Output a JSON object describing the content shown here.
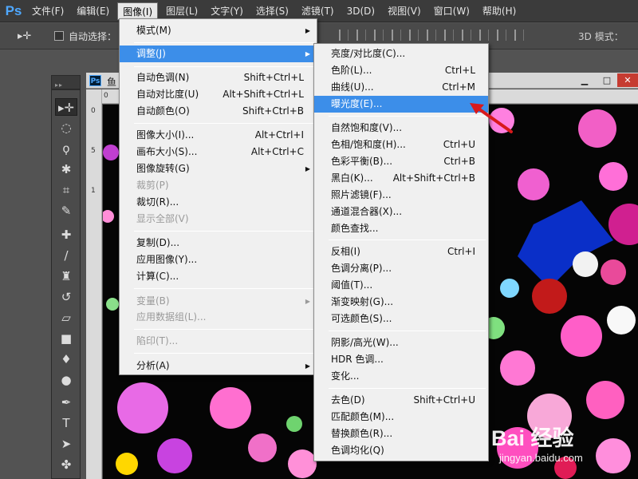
{
  "app": {
    "logo": "Ps"
  },
  "menubar": {
    "items": [
      {
        "label": "文件(F)"
      },
      {
        "label": "编辑(E)"
      },
      {
        "label": "图像(I)"
      },
      {
        "label": "图层(L)"
      },
      {
        "label": "文字(Y)"
      },
      {
        "label": "选择(S)"
      },
      {
        "label": "滤镜(T)"
      },
      {
        "label": "3D(D)"
      },
      {
        "label": "视图(V)"
      },
      {
        "label": "窗口(W)"
      },
      {
        "label": "帮助(H)"
      }
    ]
  },
  "optionsbar": {
    "auto_select_label": "自动选择：",
    "mode_3d_label": "3D 模式："
  },
  "document": {
    "title": "鱼"
  },
  "ruler": {
    "h_zero": "0",
    "v_labels": [
      "0",
      "5",
      "1"
    ]
  },
  "image_menu": {
    "items": [
      {
        "label": "模式(M)",
        "shortcut": "",
        "submenu": true,
        "disabled": false
      },
      {
        "label": "调整(J)",
        "shortcut": "",
        "submenu": true,
        "disabled": false,
        "highlight": true
      },
      {
        "label": "自动色调(N)",
        "shortcut": "Shift+Ctrl+L",
        "disabled": false
      },
      {
        "label": "自动对比度(U)",
        "shortcut": "Alt+Shift+Ctrl+L",
        "disabled": false
      },
      {
        "label": "自动颜色(O)",
        "shortcut": "Shift+Ctrl+B",
        "disabled": false
      },
      {
        "label": "图像大小(I)...",
        "shortcut": "Alt+Ctrl+I",
        "disabled": false
      },
      {
        "label": "画布大小(S)...",
        "shortcut": "Alt+Ctrl+C",
        "disabled": false
      },
      {
        "label": "图像旋转(G)",
        "shortcut": "",
        "submenu": true,
        "disabled": false
      },
      {
        "label": "裁剪(P)",
        "shortcut": "",
        "disabled": true
      },
      {
        "label": "裁切(R)...",
        "shortcut": "",
        "disabled": false
      },
      {
        "label": "显示全部(V)",
        "shortcut": "",
        "disabled": true
      },
      {
        "label": "复制(D)...",
        "shortcut": "",
        "disabled": false
      },
      {
        "label": "应用图像(Y)...",
        "shortcut": "",
        "disabled": false
      },
      {
        "label": "计算(C)...",
        "shortcut": "",
        "disabled": false
      },
      {
        "label": "变量(B)",
        "shortcut": "",
        "submenu": true,
        "disabled": true
      },
      {
        "label": "应用数据组(L)...",
        "shortcut": "",
        "disabled": true
      },
      {
        "label": "陷印(T)...",
        "shortcut": "",
        "disabled": true
      },
      {
        "label": "分析(A)",
        "shortcut": "",
        "submenu": true,
        "disabled": false
      }
    ]
  },
  "adjust_menu": {
    "items": [
      {
        "label": "亮度/对比度(C)...",
        "shortcut": ""
      },
      {
        "label": "色阶(L)...",
        "shortcut": "Ctrl+L"
      },
      {
        "label": "曲线(U)...",
        "shortcut": "Ctrl+M"
      },
      {
        "label": "曝光度(E)...",
        "shortcut": "",
        "highlight": true
      },
      {
        "label": "自然饱和度(V)...",
        "shortcut": ""
      },
      {
        "label": "色相/饱和度(H)...",
        "shortcut": "Ctrl+U"
      },
      {
        "label": "色彩平衡(B)...",
        "shortcut": "Ctrl+B"
      },
      {
        "label": "黑白(K)...",
        "shortcut": "Alt+Shift+Ctrl+B"
      },
      {
        "label": "照片滤镜(F)...",
        "shortcut": ""
      },
      {
        "label": "通道混合器(X)...",
        "shortcut": ""
      },
      {
        "label": "颜色查找...",
        "shortcut": ""
      },
      {
        "label": "反相(I)",
        "shortcut": "Ctrl+I"
      },
      {
        "label": "色调分离(P)...",
        "shortcut": ""
      },
      {
        "label": "阈值(T)...",
        "shortcut": ""
      },
      {
        "label": "渐变映射(G)...",
        "shortcut": ""
      },
      {
        "label": "可选颜色(S)...",
        "shortcut": ""
      },
      {
        "label": "阴影/高光(W)...",
        "shortcut": ""
      },
      {
        "label": "HDR 色调...",
        "shortcut": ""
      },
      {
        "label": "变化...",
        "shortcut": ""
      },
      {
        "label": "去色(D)",
        "shortcut": "Shift+Ctrl+U"
      },
      {
        "label": "匹配颜色(M)...",
        "shortcut": ""
      },
      {
        "label": "替换颜色(R)...",
        "shortcut": ""
      },
      {
        "label": "色调均化(Q)",
        "shortcut": ""
      }
    ]
  },
  "watermark": {
    "brand": "Bai 经验",
    "url": "jingyan.baidu.com"
  },
  "colors": {
    "highlight": "#3c8ee9",
    "accent_red": "#d8191c",
    "ps_blue": "#4fa8ff"
  }
}
